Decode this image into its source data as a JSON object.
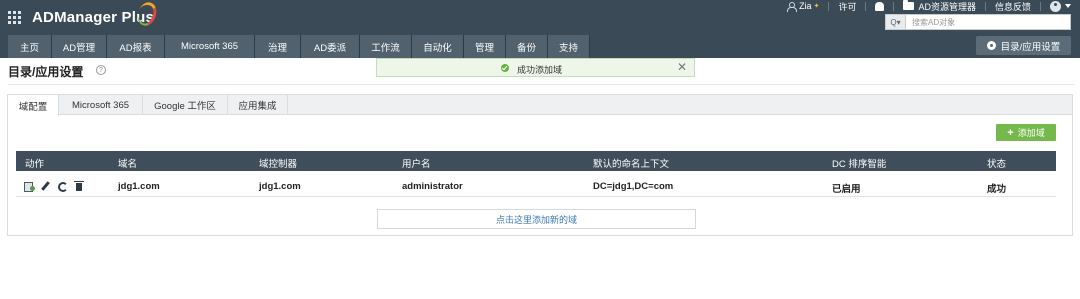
{
  "header": {
    "app_name": "ADManager Plus",
    "user": "Zia",
    "license": "许可",
    "ad_explorer": "AD资源管理器",
    "feedback": "信息反馈",
    "search": {
      "placeholder": "搜索AD对象"
    }
  },
  "nav": {
    "tabs": [
      {
        "label": "主页",
        "width": 44
      },
      {
        "label": "AD管理",
        "width": 55
      },
      {
        "label": "AD报表",
        "width": 58
      },
      {
        "label": "Microsoft 365",
        "width": 90
      },
      {
        "label": "治理",
        "width": 46
      },
      {
        "label": "AD委派",
        "width": 59
      },
      {
        "label": "工作流",
        "width": 52
      },
      {
        "label": "自动化",
        "width": 52
      },
      {
        "label": "管理",
        "width": 42
      },
      {
        "label": "备份",
        "width": 42
      },
      {
        "label": "支持",
        "width": 42
      }
    ],
    "settings_label": "目录/应用设置"
  },
  "page": {
    "title": "目录/应用设置",
    "help": "?",
    "toast": "成功添加域",
    "toast_close": "✕"
  },
  "subtabs": [
    "域配置",
    "Microsoft 365",
    "Google 工作区",
    "应用集成"
  ],
  "add_domain_label": "添加域",
  "table": {
    "columns": [
      "动作",
      "域名",
      "域控制器",
      "用户名",
      "默认的命名上下文",
      "DC 排序智能",
      "状态"
    ],
    "rows": [
      {
        "domain": "jdg1.com",
        "dc": "jdg1.com",
        "username": "administrator",
        "naming_context": "DC=jdg1,DC=com",
        "dc_smart": "已启用",
        "status": "成功"
      }
    ]
  },
  "add_new_domain_link": "点击这里添加新的域",
  "colors": {
    "header_bg": "#3a4a57",
    "table_header_bg": "#3f4e5a",
    "accent_green": "#75b84b",
    "link_blue": "#3d7ab8"
  }
}
